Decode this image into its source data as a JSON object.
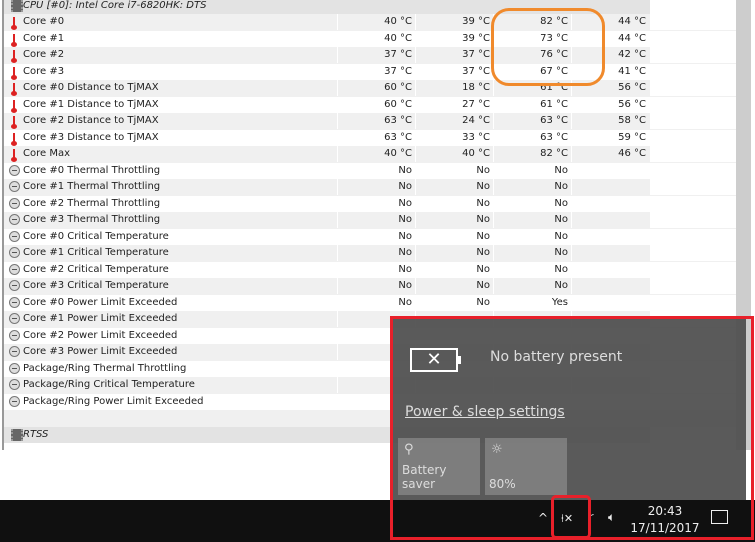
{
  "sensor_table": {
    "group_header": "CPU [#0]: Intel Core i7-6820HK: DTS",
    "rows": [
      {
        "icon": "thermometer-icon",
        "label": "Core #0",
        "values": [
          "40 °C",
          "39 °C",
          "82 °C",
          "44 °C"
        ]
      },
      {
        "icon": "thermometer-icon",
        "label": "Core #1",
        "values": [
          "40 °C",
          "39 °C",
          "73 °C",
          "44 °C"
        ]
      },
      {
        "icon": "thermometer-icon",
        "label": "Core #2",
        "values": [
          "37 °C",
          "37 °C",
          "76 °C",
          "42 °C"
        ]
      },
      {
        "icon": "thermometer-icon",
        "label": "Core #3",
        "values": [
          "37 °C",
          "37 °C",
          "67 °C",
          "41 °C"
        ]
      },
      {
        "icon": "thermometer-icon",
        "label": "Core #0 Distance to TjMAX",
        "values": [
          "60 °C",
          "18 °C",
          "61 °C",
          "56 °C"
        ]
      },
      {
        "icon": "thermometer-icon",
        "label": "Core #1 Distance to TjMAX",
        "values": [
          "60 °C",
          "27 °C",
          "61 °C",
          "56 °C"
        ]
      },
      {
        "icon": "thermometer-icon",
        "label": "Core #2 Distance to TjMAX",
        "values": [
          "63 °C",
          "24 °C",
          "63 °C",
          "58 °C"
        ]
      },
      {
        "icon": "thermometer-icon",
        "label": "Core #3 Distance to TjMAX",
        "values": [
          "63 °C",
          "33 °C",
          "63 °C",
          "59 °C"
        ]
      },
      {
        "icon": "thermometer-icon",
        "label": "Core Max",
        "values": [
          "40 °C",
          "40 °C",
          "82 °C",
          "46 °C"
        ]
      },
      {
        "icon": "status-circle-icon",
        "label": "Core #0 Thermal Throttling",
        "values": [
          "No",
          "No",
          "No",
          ""
        ]
      },
      {
        "icon": "status-circle-icon",
        "label": "Core #1 Thermal Throttling",
        "values": [
          "No",
          "No",
          "No",
          ""
        ]
      },
      {
        "icon": "status-circle-icon",
        "label": "Core #2 Thermal Throttling",
        "values": [
          "No",
          "No",
          "No",
          ""
        ]
      },
      {
        "icon": "status-circle-icon",
        "label": "Core #3 Thermal Throttling",
        "values": [
          "No",
          "No",
          "No",
          ""
        ]
      },
      {
        "icon": "status-circle-icon",
        "label": "Core #0 Critical Temperature",
        "values": [
          "No",
          "No",
          "No",
          ""
        ]
      },
      {
        "icon": "status-circle-icon",
        "label": "Core #1 Critical Temperature",
        "values": [
          "No",
          "No",
          "No",
          ""
        ]
      },
      {
        "icon": "status-circle-icon",
        "label": "Core #2 Critical Temperature",
        "values": [
          "No",
          "No",
          "No",
          ""
        ]
      },
      {
        "icon": "status-circle-icon",
        "label": "Core #3 Critical Temperature",
        "values": [
          "No",
          "No",
          "No",
          ""
        ]
      },
      {
        "icon": "status-circle-icon",
        "label": "Core #0 Power Limit Exceeded",
        "values": [
          "No",
          "No",
          "Yes",
          ""
        ]
      },
      {
        "icon": "status-circle-icon",
        "label": "Core #1 Power Limit Exceeded",
        "values": [
          "",
          "",
          "",
          ""
        ]
      },
      {
        "icon": "status-circle-icon",
        "label": "Core #2 Power Limit Exceeded",
        "values": [
          "",
          "",
          "",
          ""
        ]
      },
      {
        "icon": "status-circle-icon",
        "label": "Core #3 Power Limit Exceeded",
        "values": [
          "",
          "",
          "",
          ""
        ]
      },
      {
        "icon": "status-circle-icon",
        "label": "Package/Ring Thermal Throttling",
        "values": [
          "",
          "",
          "",
          ""
        ]
      },
      {
        "icon": "status-circle-icon",
        "label": "Package/Ring Critical Temperature",
        "values": [
          "",
          "",
          "",
          ""
        ]
      },
      {
        "icon": "status-circle-icon",
        "label": "Package/Ring Power Limit Exceeded",
        "values": [
          "",
          "",
          "",
          ""
        ]
      }
    ],
    "second_group_header": "RTSS"
  },
  "battery_flyout": {
    "status": "No battery present",
    "settings_link": "Power & sleep settings",
    "tiles": [
      {
        "icon": "leaf-icon",
        "label": "Battery saver"
      },
      {
        "icon": "brightness-icon",
        "label": "80%"
      }
    ]
  },
  "taskbar": {
    "time": "20:43",
    "date": "17/11/2017"
  },
  "colors": {
    "annotation_orange": "#f08a2c",
    "annotation_red": "#e8202a",
    "temperature_icon": "#d22222"
  }
}
